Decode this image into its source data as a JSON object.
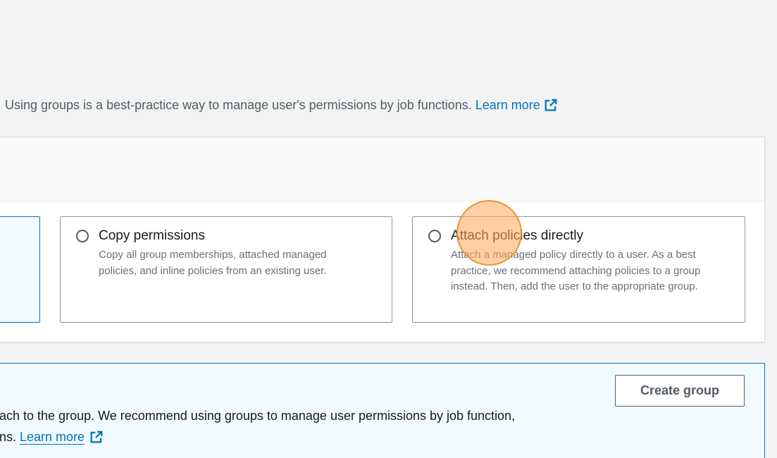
{
  "intro": {
    "text": "Using groups is a best-practice way to manage user's permissions by job functions.",
    "link_label": "Learn more"
  },
  "options": [
    {
      "title": "",
      "description": "",
      "selected": true
    },
    {
      "title": "Copy permissions",
      "description": "Copy all group memberships, attached managed policies, and inline policies from an existing user.",
      "selected": false
    },
    {
      "title": "Attach policies directly",
      "description": "Attach a managed policy directly to a user. As a best practice, we recommend attaching policies to a group instead. Then, add the user to the appropriate group.",
      "selected": false
    }
  ],
  "groups_panel": {
    "line1": "ach to the group. We recommend using groups to manage user permissions by job function,",
    "line2_prefix": "ns. ",
    "link_label": "Learn more",
    "create_group_label": "Create group"
  },
  "icons": {
    "external_link": "external-link-icon",
    "radio": "radio-button-icon"
  },
  "colors": {
    "link": "#0073bb",
    "selected_tile_bg": "#f1faff",
    "selected_tile_border": "#0073bb",
    "page_bg": "#f2f3f3",
    "cursor_highlight": "#ffaa5a"
  }
}
